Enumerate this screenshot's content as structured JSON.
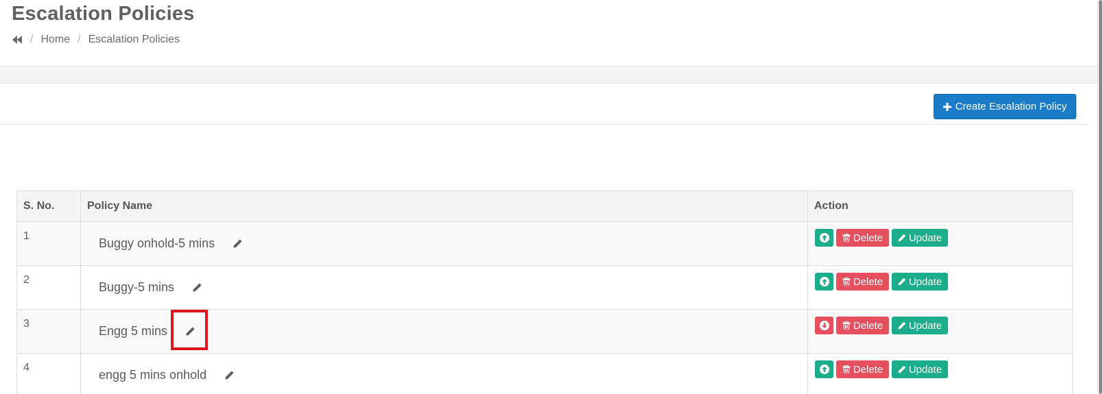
{
  "header": {
    "title": "Escalation Policies",
    "breadcrumb": {
      "home": "Home",
      "current": "Escalation Policies"
    }
  },
  "toolbar": {
    "create_label": "Create Escalation Policy"
  },
  "table": {
    "headers": {
      "sno": "S. No.",
      "name": "Policy Name",
      "action": "Action"
    },
    "rows": [
      {
        "sno": "1",
        "name": "Buggy onhold-5 mins",
        "toggle": "up",
        "delete": "Delete",
        "update": "Update"
      },
      {
        "sno": "2",
        "name": "Buggy-5 mins",
        "toggle": "up",
        "delete": "Delete",
        "update": "Update"
      },
      {
        "sno": "3",
        "name": "Engg 5 mins",
        "toggle": "down",
        "delete": "Delete",
        "update": "Update"
      },
      {
        "sno": "4",
        "name": "engg 5 mins onhold",
        "toggle": "up",
        "delete": "Delete",
        "update": "Update"
      }
    ]
  },
  "colors": {
    "primary": "#1a7cc8",
    "success": "#1cae8a",
    "danger": "#e54f5e",
    "highlight": "#e0141b"
  },
  "icons": {
    "back": "double-chevron-left-icon",
    "edit": "pencil-icon",
    "toggle_up": "arrow-circle-up-icon",
    "toggle_down": "arrow-circle-down-icon",
    "delete": "trash-icon",
    "update": "pencil-icon",
    "create": "plus-icon"
  }
}
